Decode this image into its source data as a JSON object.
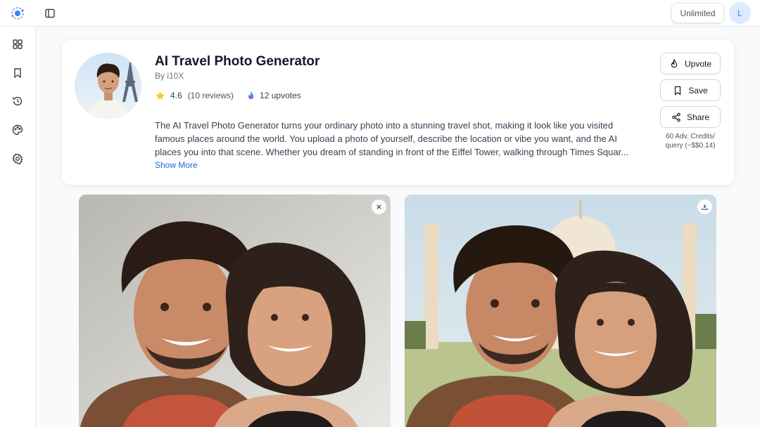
{
  "header": {
    "logo_icon": "orbit-logo-icon",
    "sidebar_toggle_icon": "sidebar-toggle-icon",
    "plan_label": "Unlimited",
    "avatar_initial": "L"
  },
  "rail": {
    "items": [
      {
        "icon": "grid-icon"
      },
      {
        "icon": "bookmark-icon"
      },
      {
        "icon": "history-icon"
      },
      {
        "icon": "palette-icon"
      },
      {
        "icon": "settings-icon"
      }
    ]
  },
  "tool": {
    "title": "AI Travel Photo Generator",
    "author": "By i10X",
    "rating": "4.6",
    "reviews": "(10 reviews)",
    "upvotes": "12 upvotes",
    "description_lines": [
      "The AI Travel Photo Generator turns your ordinary photo into a stunning travel shot, making it look like you visited",
      "famous places around the world. You upload a photo of yourself, describe the location or vibe you want, and the AI",
      "places you into that scene. Whether you dream of standing in front of the Eiffel Tower, walking through Times Squar..."
    ],
    "show_more": "Show More",
    "actions": {
      "upvote": "Upvote",
      "save": "Save",
      "share": "Share"
    },
    "credits_line1": "60 Adv. Credits/",
    "credits_line2": "query (~$$0.14)"
  },
  "gallery": {
    "input_photo_action_icon": "close-icon",
    "output_photo_action_icon": "download-icon"
  },
  "colors": {
    "accent": "#2563eb",
    "border": "#e5e7eb",
    "star": "#facc15"
  }
}
